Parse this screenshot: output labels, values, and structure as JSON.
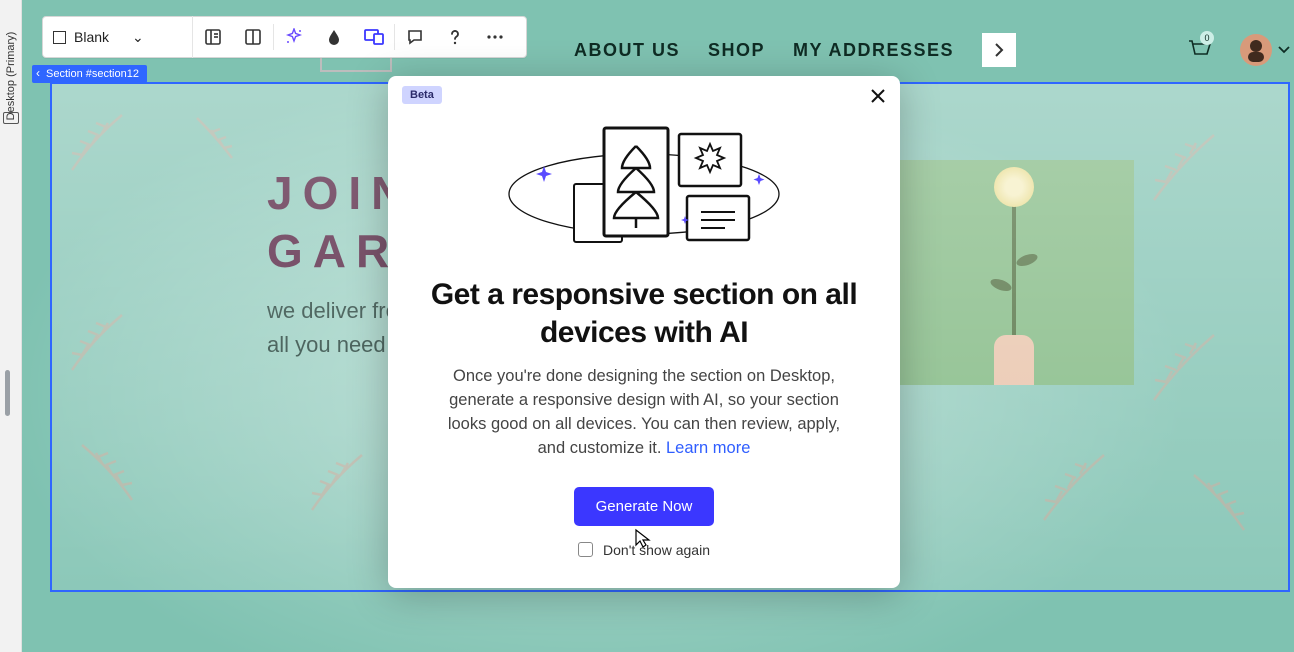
{
  "device_rail": {
    "label": "Desktop (Primary)"
  },
  "toolbar": {
    "select_label": "Blank"
  },
  "section_tag": "Section #section12",
  "site_nav": {
    "about": "ABOUT US",
    "shop": "SHOP",
    "addresses": "MY ADDRESSES",
    "cart_count": "0"
  },
  "hero": {
    "title_line1": "JOIN",
    "title_line2": "GAR",
    "para1": "we deliver fresh week.",
    "para2": "all you need to d preferences - w"
  },
  "modal": {
    "beta": "Beta",
    "title": "Get a responsive section on all devices with AI",
    "body": "Once you're done designing the section on Desktop, generate a responsive design with AI, so your section looks good on all devices. You can then review, apply, and customize it. ",
    "learn_more": "Learn more",
    "cta": "Generate Now",
    "dont_show": "Don't show again"
  }
}
